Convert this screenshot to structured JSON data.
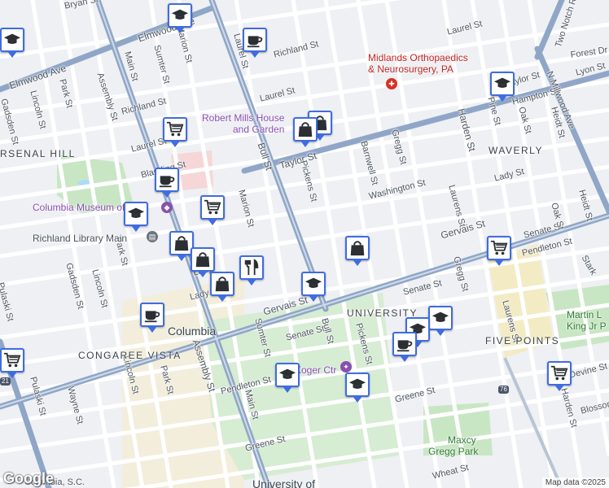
{
  "map": {
    "credit": "Map data ©2025",
    "logo": "Google",
    "streets": [
      {
        "id": "bryan",
        "text": "Bryan St"
      },
      {
        "id": "marion-n",
        "text": "Marion St"
      },
      {
        "id": "elmwood1",
        "text": "Elmwood Ave"
      },
      {
        "id": "elmwood2",
        "text": "Elmwood Ave"
      },
      {
        "id": "sumter-n",
        "text": "Sumter St"
      },
      {
        "id": "main-n",
        "text": "Main St"
      },
      {
        "id": "richland1",
        "text": "Richland St"
      },
      {
        "id": "richland2",
        "text": "Richland St"
      },
      {
        "id": "laurel-n",
        "text": "Laurel St"
      },
      {
        "id": "laurel2",
        "text": "Laurel St"
      },
      {
        "id": "laurel-w",
        "text": "Laurel St"
      },
      {
        "id": "laurel-ne",
        "text": "Laurel St"
      },
      {
        "id": "park-n",
        "text": "Park St"
      },
      {
        "id": "lincoln-n",
        "text": "Lincoln St"
      },
      {
        "id": "gadsden-n",
        "text": "Gadsden St"
      },
      {
        "id": "assembly-n",
        "text": "Assembly St"
      },
      {
        "id": "bull-n",
        "text": "Bull St"
      },
      {
        "id": "taylor",
        "text": "Taylor St"
      },
      {
        "id": "taylor-e",
        "text": "Taylor St"
      },
      {
        "id": "pickens-n",
        "text": "Pickens St"
      },
      {
        "id": "barnwell",
        "text": "Barnwell St"
      },
      {
        "id": "gregg-n",
        "text": "Gregg St"
      },
      {
        "id": "washington",
        "text": "Washington St"
      },
      {
        "id": "harden-n",
        "text": "Harden St"
      },
      {
        "id": "hampton",
        "text": "Hampton St"
      },
      {
        "id": "pine",
        "text": "Pine St"
      },
      {
        "id": "oak",
        "text": "Oak St"
      },
      {
        "id": "heidt-n",
        "text": "Heidt St"
      },
      {
        "id": "lyon",
        "text": "Lyon St"
      },
      {
        "id": "forest",
        "text": "Forest Dr"
      },
      {
        "id": "twonotch",
        "text": "Two Notch Rd"
      },
      {
        "id": "millwood",
        "text": "N Millwood Ave"
      },
      {
        "id": "lady-e",
        "text": "Lady St"
      },
      {
        "id": "lady-w",
        "text": "Lady St"
      },
      {
        "id": "laurens-n",
        "text": "Laurens St"
      },
      {
        "id": "marion-m",
        "text": "Marion St"
      },
      {
        "id": "blanding",
        "text": "Blanding St"
      },
      {
        "id": "park-m",
        "text": "Park St"
      },
      {
        "id": "gervais-w",
        "text": "Gervais St"
      },
      {
        "id": "gervais-e",
        "text": "Gervais St"
      },
      {
        "id": "senate-e",
        "text": "Senate St"
      },
      {
        "id": "senate-m",
        "text": "Senate St"
      },
      {
        "id": "senate-w",
        "text": "Senate St"
      },
      {
        "id": "pendleton-e",
        "text": "Pendleton St"
      },
      {
        "id": "pendleton-w",
        "text": "Pendleton St"
      },
      {
        "id": "stark",
        "text": "Stark"
      },
      {
        "id": "heidt-m",
        "text": "Heidt St"
      },
      {
        "id": "oak-m",
        "text": "Oak St"
      },
      {
        "id": "gregg-m",
        "text": "Gregg St"
      },
      {
        "id": "laurens-m",
        "text": "Laurens St"
      },
      {
        "id": "lincoln-m",
        "text": "Lincoln St"
      },
      {
        "id": "gadsden-s",
        "text": "Gadsden St"
      },
      {
        "id": "pulaski",
        "text": "Pulaski St"
      },
      {
        "id": "pulaski2",
        "text": "Pulaski St"
      },
      {
        "id": "wayne",
        "text": "Wayne St"
      },
      {
        "id": "lincoln-s",
        "text": "Lincoln St"
      },
      {
        "id": "park-s",
        "text": "Park St"
      },
      {
        "id": "assembly-s",
        "text": "Assembly St"
      },
      {
        "id": "sumter-s",
        "text": "Sumter St"
      },
      {
        "id": "main-s",
        "text": "Main St"
      },
      {
        "id": "bull-s",
        "text": "Bull St"
      },
      {
        "id": "pickens-s",
        "text": "Pickens St"
      },
      {
        "id": "greene-w",
        "text": "Greene St"
      },
      {
        "id": "greene-e",
        "text": "Greene St"
      },
      {
        "id": "devine",
        "text": "Devine St"
      },
      {
        "id": "blossom",
        "text": "Blosson"
      },
      {
        "id": "wheat",
        "text": "Wheat St"
      },
      {
        "id": "harden-s",
        "text": "Harden St"
      },
      {
        "id": "lady-s",
        "text": "Lady"
      }
    ],
    "areas": [
      {
        "id": "arsenal",
        "text": "RSENAL HILL"
      },
      {
        "id": "waverly",
        "text": "WAVERLY"
      },
      {
        "id": "vista",
        "text": "CONGAREE VISTA"
      },
      {
        "id": "fivepoints",
        "text": "FIVE POINTS"
      },
      {
        "id": "university",
        "text": "UNIVERSITY"
      }
    ],
    "places": [
      {
        "id": "midlands1",
        "text": "Midlands Orthopaedics"
      },
      {
        "id": "midlands2",
        "text": "& Neurosurgery, PA"
      },
      {
        "id": "robert1",
        "text": "Robert Mills House"
      },
      {
        "id": "robert2",
        "text": "and Garden"
      },
      {
        "id": "museum",
        "text": "Columbia Museum of Art"
      },
      {
        "id": "library",
        "text": "Richland Library Main"
      },
      {
        "id": "columbia",
        "text": "Columbia"
      },
      {
        "id": "koger",
        "text": "Koger Ctr"
      },
      {
        "id": "mlk1",
        "text": "Martin L"
      },
      {
        "id": "mlk2",
        "text": "King Jr P"
      },
      {
        "id": "maxcy1",
        "text": "Maxcy"
      },
      {
        "id": "maxcy2",
        "text": "Gregg Park"
      },
      {
        "id": "usc",
        "text": "University of"
      },
      {
        "id": "cola-sc",
        "text": "Columbia, S.C."
      }
    ],
    "shields": [
      {
        "id": "us76",
        "text": "76"
      },
      {
        "id": "us21",
        "text": "21"
      }
    ],
    "markers": [
      {
        "id": "m1",
        "icon": "graduation-cap-icon"
      },
      {
        "id": "m2",
        "icon": "graduation-cap-icon"
      },
      {
        "id": "m3",
        "icon": "coffee-cup-icon"
      },
      {
        "id": "m4",
        "icon": "graduation-cap-icon"
      },
      {
        "id": "m5",
        "icon": "shopping-cart-icon"
      },
      {
        "id": "m6",
        "icon": "shopping-bag-icon"
      },
      {
        "id": "m7",
        "icon": "coffee-cup-icon"
      },
      {
        "id": "m8",
        "icon": "shopping-bag-icon"
      },
      {
        "id": "m9",
        "icon": "graduation-cap-icon"
      },
      {
        "id": "m10",
        "icon": "shopping-cart-icon"
      },
      {
        "id": "m11",
        "icon": "shopping-bag-icon"
      },
      {
        "id": "m12",
        "icon": "shopping-bag-icon"
      },
      {
        "id": "m13",
        "icon": "utensils-icon"
      },
      {
        "id": "m14",
        "icon": "shopping-bag-icon"
      },
      {
        "id": "m15",
        "icon": "graduation-cap-icon"
      },
      {
        "id": "m16",
        "icon": "coffee-cup-icon"
      },
      {
        "id": "m17",
        "icon": "graduation-cap-icon"
      },
      {
        "id": "m18",
        "icon": "graduation-cap-icon"
      },
      {
        "id": "m19",
        "icon": "coffee-cup-icon"
      },
      {
        "id": "m20",
        "icon": "shopping-cart-icon"
      },
      {
        "id": "m21",
        "icon": "graduation-cap-icon"
      },
      {
        "id": "m22",
        "icon": "graduation-cap-icon"
      },
      {
        "id": "m23",
        "icon": "shopping-cart-icon"
      },
      {
        "id": "m24",
        "icon": "shopping-cart-icon"
      }
    ],
    "colors": {
      "marker_border": "#3f6ce0",
      "road_major": "#8fa6c7",
      "road_minor": "#ffffff",
      "park": "#c9e6c4",
      "campus": "#d6ecd3",
      "water": "#aadaff",
      "highlight": "#f6e7a5"
    }
  }
}
